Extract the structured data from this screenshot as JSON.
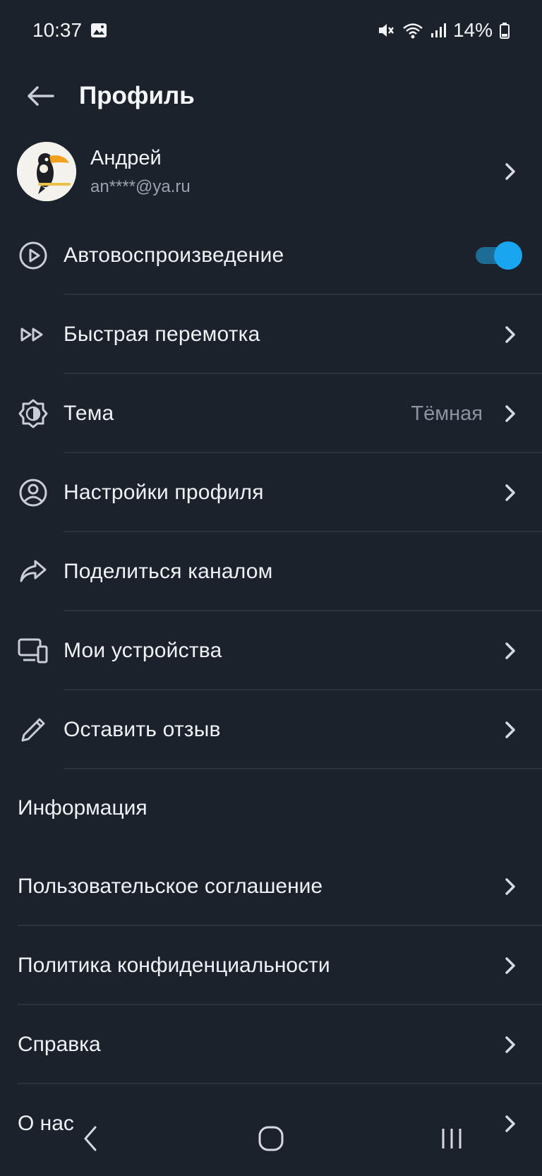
{
  "status": {
    "time": "10:37",
    "battery": "14%",
    "icons": [
      "gallery-icon",
      "mute-icon",
      "wifi-icon",
      "signal-icon",
      "battery-icon"
    ]
  },
  "header": {
    "title": "Профиль",
    "back_icon": "arrow-left-icon"
  },
  "profile": {
    "name": "Андрей",
    "email": "an****@ya.ru",
    "avatar_icon": "toucan-avatar"
  },
  "menu": {
    "autoplay": {
      "label": "Автовоспроизведение",
      "icon": "play-circle-icon",
      "enabled": true
    },
    "fast_forward": {
      "label": "Быстрая перемотка",
      "icon": "fast-forward-icon"
    },
    "theme": {
      "label": "Тема",
      "value": "Тёмная",
      "icon": "brightness-icon"
    },
    "profile_settings": {
      "label": "Настройки профиля",
      "icon": "user-circle-icon"
    },
    "share_channel": {
      "label": "Поделиться каналом",
      "icon": "share-arrow-icon"
    },
    "devices": {
      "label": "Мои устройства",
      "icon": "devices-icon"
    },
    "feedback": {
      "label": "Оставить отзыв",
      "icon": "pencil-icon"
    }
  },
  "info": {
    "title": "Информация",
    "items": [
      {
        "label": "Пользовательское соглашение"
      },
      {
        "label": "Политика конфиденциальности"
      },
      {
        "label": "Справка"
      },
      {
        "label": "О нас"
      }
    ]
  },
  "colors": {
    "background": "#1c222b",
    "accent": "#19a6f0",
    "text": "#eef1f5",
    "muted": "#8a93a0"
  }
}
